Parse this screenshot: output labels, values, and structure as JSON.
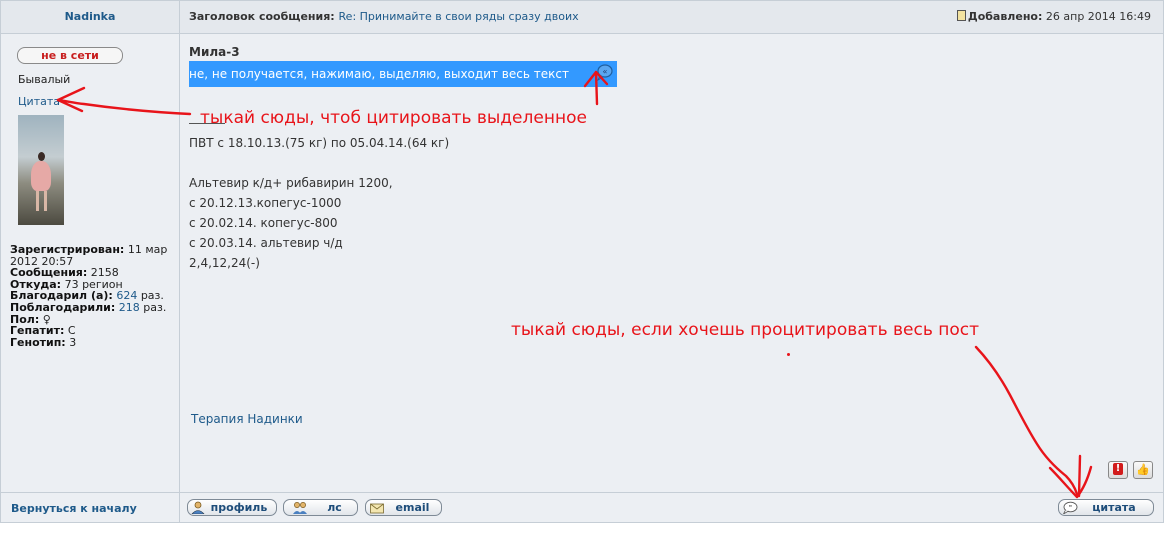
{
  "header": {
    "author": "Nadinka",
    "subject_label": "Заголовок сообщения:",
    "subject": "Re: Принимайте в свои ряды сразу двоих",
    "date_label": "Добавлено:",
    "date": "26 апр 2014 16:49"
  },
  "profile": {
    "status_button": "не в сети",
    "rank": "Бывалый",
    "quote_link": "Цитата",
    "stats": [
      {
        "label": "Зарегистрирован:",
        "value": "11 мар 2012 20:57"
      },
      {
        "label": "Сообщения:",
        "value": "2158"
      },
      {
        "label": "Откуда:",
        "value": "73 регион"
      },
      {
        "label": "Благодарил (а):",
        "value": "624",
        "suffix": "раз."
      },
      {
        "label": "Поблагодарили:",
        "value": "218",
        "suffix": "раз."
      },
      {
        "label": "Пол:",
        "value": "♀"
      },
      {
        "label": "Гепатит:",
        "value": "C"
      },
      {
        "label": "Генотип:",
        "value": "3"
      }
    ]
  },
  "post": {
    "quote_author": "Мила-3",
    "selected_text": "не, не получается, нажимаю, выделяю, выходит весь текст",
    "signature_lines": [
      "ПВТ с 18.10.13.(75 кг) по 05.04.14.(64 кг)",
      "",
      "Альтевир к/д+ рибавирин 1200,",
      "с 20.12.13.копегус-1000",
      "с 20.02.14. копегус-800",
      "с 20.03.14. альтевир ч/д",
      "2,4,12,24(-)"
    ],
    "therapy_link": "Терапия Надинки"
  },
  "footer": {
    "back_to_top": "Вернуться к началу",
    "profile_button": "профиль",
    "pm_button": "лс",
    "email_button": "email",
    "quote_button": "цитата"
  },
  "annotations": {
    "quote_selection_hint": "тыкай сюды, чтоб цитировать выделенное",
    "quote_all_hint": "тыкай сюды, если хочешь процитировать весь пост"
  },
  "colors": {
    "link": "#1e5a8a",
    "annotation": "#e8141a",
    "selection": "#3399ff",
    "offline": "#c81e1e"
  },
  "icons": [
    "document-icon",
    "quote-selection-icon",
    "report-icon",
    "thanks-icon",
    "profile-icon",
    "pm-icon",
    "email-icon",
    "quote-bubble-icon"
  ]
}
